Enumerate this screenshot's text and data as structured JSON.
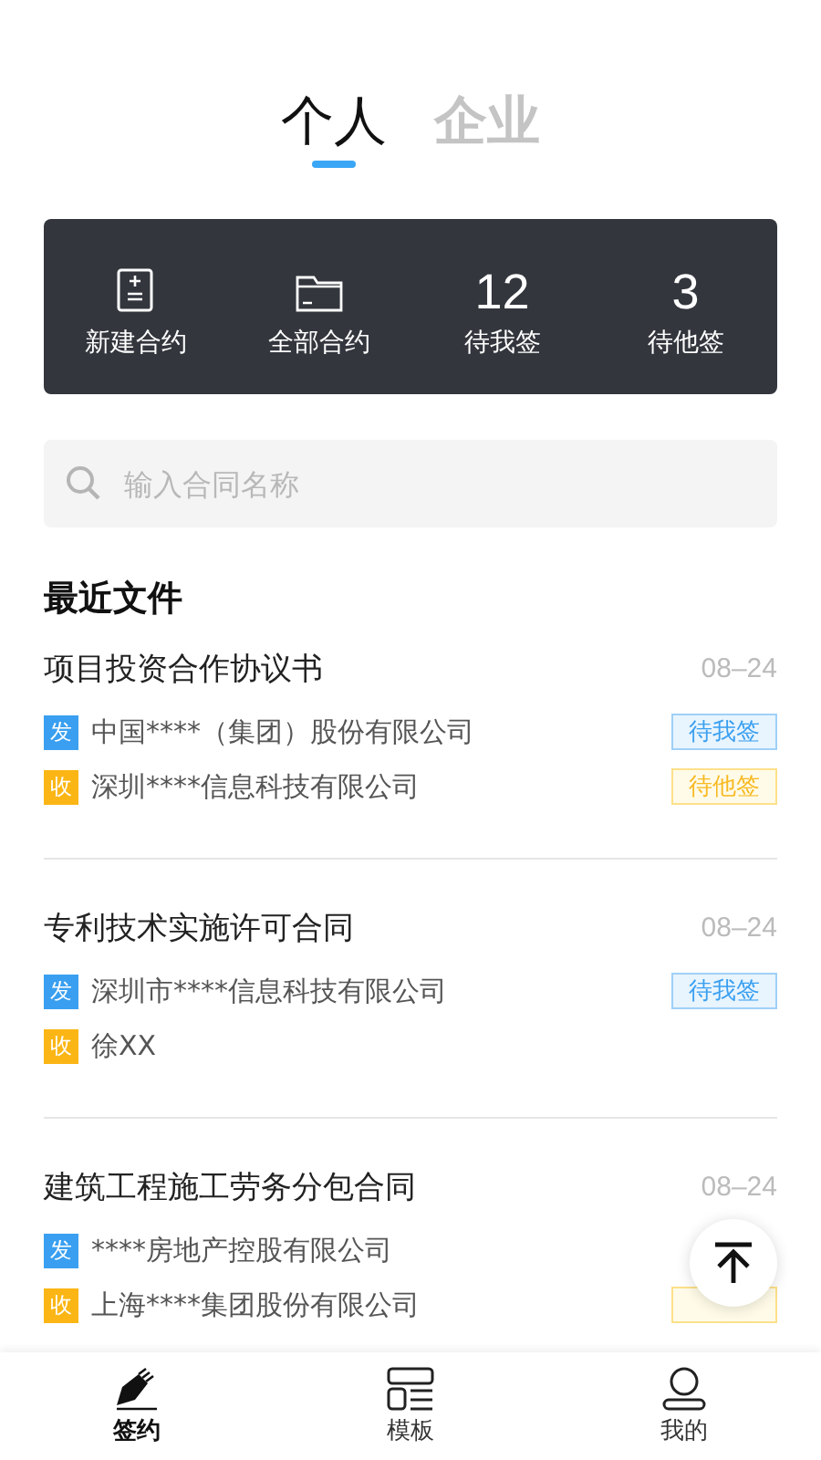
{
  "tabs": [
    {
      "label": "个人",
      "selected": true
    },
    {
      "label": "企业",
      "selected": false
    }
  ],
  "dashboard": [
    {
      "kind": "new",
      "label": "新建合约"
    },
    {
      "kind": "folder",
      "label": "全部合约"
    },
    {
      "kind": "count",
      "value": "12",
      "label": "待我签"
    },
    {
      "kind": "count",
      "value": "3",
      "label": "待他签"
    }
  ],
  "search": {
    "placeholder": "输入合同名称"
  },
  "section_title": "最近文件",
  "documents": [
    {
      "title": "项目投资合作协议书",
      "date": "08–24",
      "parties": [
        {
          "kind": "send",
          "tag": "发",
          "name": "中国****（集团）股份有限公司",
          "status": {
            "kind": "mine",
            "label": "待我签"
          }
        },
        {
          "kind": "receive",
          "tag": "收",
          "name": "深圳****信息科技有限公司",
          "status": {
            "kind": "other",
            "label": "待他签"
          }
        }
      ]
    },
    {
      "title": "专利技术实施许可合同",
      "date": "08–24",
      "parties": [
        {
          "kind": "send",
          "tag": "发",
          "name": "深圳市****信息科技有限公司",
          "status": {
            "kind": "mine",
            "label": "待我签"
          }
        },
        {
          "kind": "receive",
          "tag": "收",
          "name": "徐XX"
        }
      ]
    },
    {
      "title": "建筑工程施工劳务分包合同",
      "date": "08–24",
      "parties": [
        {
          "kind": "send",
          "tag": "发",
          "name": "****房地产控股有限公司"
        },
        {
          "kind": "receive",
          "tag": "收",
          "name": "上海****集团股份有限公司",
          "status": {
            "kind": "other"
          }
        }
      ]
    }
  ],
  "nav": [
    {
      "kind": "sign",
      "label": "签约",
      "selected": true
    },
    {
      "kind": "template",
      "label": "模板",
      "selected": false
    },
    {
      "kind": "profile",
      "label": "我的",
      "selected": false
    }
  ]
}
